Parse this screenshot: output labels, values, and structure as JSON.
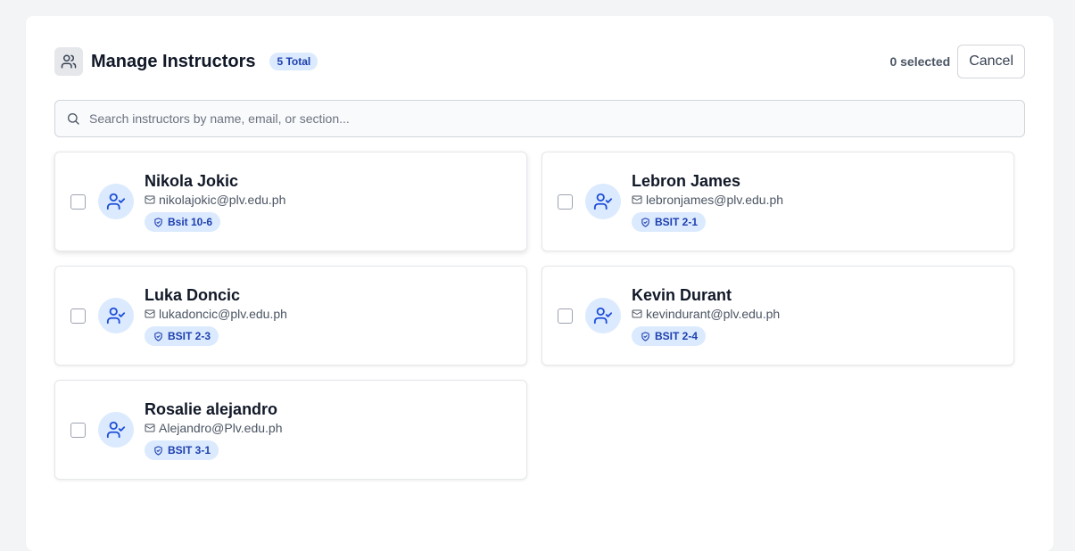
{
  "header": {
    "title": "Manage Instructors",
    "total_badge": "5 Total",
    "selected_count": "0 selected",
    "cancel_label": "Cancel"
  },
  "search": {
    "placeholder": "Search instructors by name, email, or section...",
    "value": ""
  },
  "instructors": [
    {
      "name": "Nikola Jokic",
      "email": "nikolajokic@plv.edu.ph",
      "section": "Bsit 10-6",
      "checked": false
    },
    {
      "name": "Lebron James",
      "email": "lebronjames@plv.edu.ph",
      "section": "BSIT 2-1",
      "checked": false
    },
    {
      "name": "Luka Doncic",
      "email": "lukadoncic@plv.edu.ph",
      "section": "BSIT 2-3",
      "checked": false
    },
    {
      "name": "Kevin Durant",
      "email": "kevindurant@plv.edu.ph",
      "section": "BSIT 2-4",
      "checked": false
    },
    {
      "name": "Rosalie alejandro",
      "email": "Alejandro@Plv.edu.ph",
      "section": "BSIT 3-1",
      "checked": false
    }
  ],
  "icons": {
    "header": "users-icon",
    "search": "search-icon",
    "avatar": "user-check-icon",
    "email": "mail-icon",
    "section": "shield-check-icon"
  },
  "colors": {
    "accent": "#1d4ed8",
    "badge_bg": "#dbeafe",
    "badge_text": "#1e40af"
  }
}
